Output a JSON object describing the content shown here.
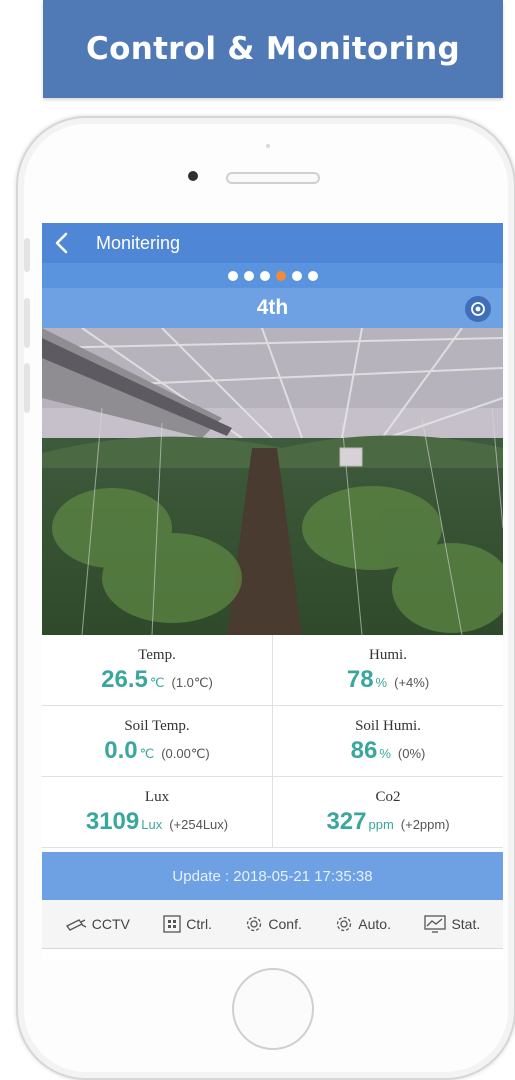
{
  "banner": {
    "title": "Control & Monitoring"
  },
  "app": {
    "nav_title": "Monitering",
    "pager": {
      "count": 6,
      "active_index": 3
    },
    "section_title": "4th",
    "sensors": [
      {
        "label": "Temp.",
        "value": "26.5",
        "unit": "℃",
        "delta": "(1.0℃)"
      },
      {
        "label": "Humi.",
        "value": "78",
        "unit": "%",
        "delta": "(+4%)"
      },
      {
        "label": "Soil Temp.",
        "value": "0.0",
        "unit": "℃",
        "delta": "(0.00℃)"
      },
      {
        "label": "Soil Humi.",
        "value": "86",
        "unit": "%",
        "delta": "(0%)"
      },
      {
        "label": "Lux",
        "value": "3109",
        "unit": "Lux",
        "delta": "(+254Lux)"
      },
      {
        "label": "Co2",
        "value": "327",
        "unit": "ppm",
        "delta": "(+2ppm)"
      }
    ],
    "update_text": "Update : 2018-05-21 17:35:38",
    "tabs": [
      {
        "label": "CCTV",
        "icon": "cctv-icon"
      },
      {
        "label": "Ctrl.",
        "icon": "control-grid-icon"
      },
      {
        "label": "Conf.",
        "icon": "gear-icon"
      },
      {
        "label": "Auto.",
        "icon": "gear-icon"
      },
      {
        "label": "Stat.",
        "icon": "chart-icon"
      }
    ]
  },
  "colors": {
    "banner": "#4f7ab5",
    "navbar": "#4f87d6",
    "subheader": "#6ea1e3",
    "value_teal": "#3aa79e",
    "active_dot": "#f08a3c"
  }
}
